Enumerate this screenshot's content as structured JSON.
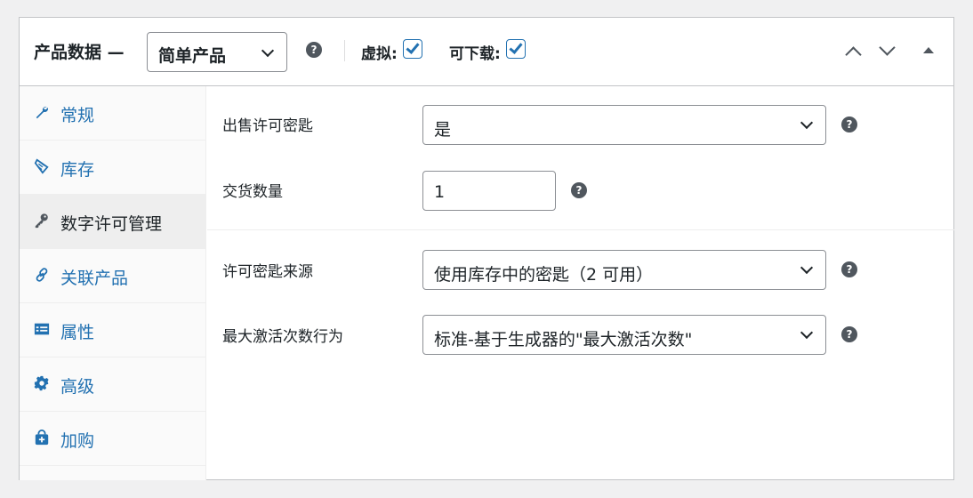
{
  "header": {
    "title": "产品数据 —",
    "product_type": "简单产品",
    "virtual_label": "虚拟:",
    "virtual_checked": true,
    "downloadable_label": "可下载:",
    "downloadable_checked": true,
    "help_glyph": "?"
  },
  "sidebar": {
    "items": [
      {
        "label": "常规",
        "icon": "wrench-icon"
      },
      {
        "label": "库存",
        "icon": "tag-icon"
      },
      {
        "label": "数字许可管理",
        "icon": "key-icon",
        "active": true
      },
      {
        "label": "关联产品",
        "icon": "link-icon"
      },
      {
        "label": "属性",
        "icon": "list-icon"
      },
      {
        "label": "高级",
        "icon": "gear-icon"
      },
      {
        "label": "加购",
        "icon": "cart-add-icon"
      }
    ]
  },
  "fields": {
    "sell_license_label": "出售许可密匙",
    "sell_license_value": "是",
    "delivery_qty_label": "交货数量",
    "delivery_qty_value": "1",
    "key_source_label": "许可密匙来源",
    "key_source_value": "使用库存中的密匙（2 可用）",
    "max_activation_label": "最大激活次数行为",
    "max_activation_value": "标准-基于生成器的\"最大激活次数\""
  },
  "colors": {
    "accent": "#2271b1",
    "text": "#1d2327",
    "icon_gray": "#50575e"
  }
}
